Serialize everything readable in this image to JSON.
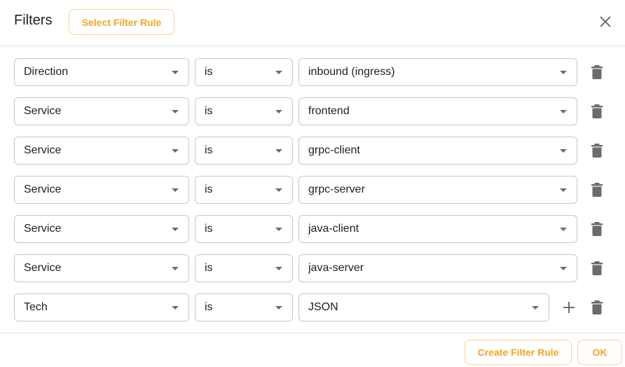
{
  "dialog": {
    "title": "Filters",
    "select_rule_label": "Select Filter Rule",
    "close_icon": "close-icon"
  },
  "accent_color": "#f5a524",
  "rules": [
    {
      "field": "Direction",
      "operator": "is",
      "value": "inbound (ingress)"
    },
    {
      "field": "Service",
      "operator": "is",
      "value": "frontend"
    },
    {
      "field": "Service",
      "operator": "is",
      "value": "grpc-client"
    },
    {
      "field": "Service",
      "operator": "is",
      "value": "grpc-server"
    },
    {
      "field": "Service",
      "operator": "is",
      "value": "java-client"
    },
    {
      "field": "Service",
      "operator": "is",
      "value": "java-server"
    },
    {
      "field": "Tech",
      "operator": "is",
      "value": "JSON"
    }
  ],
  "footer": {
    "create_label": "Create Filter Rule",
    "ok_label": "OK"
  }
}
